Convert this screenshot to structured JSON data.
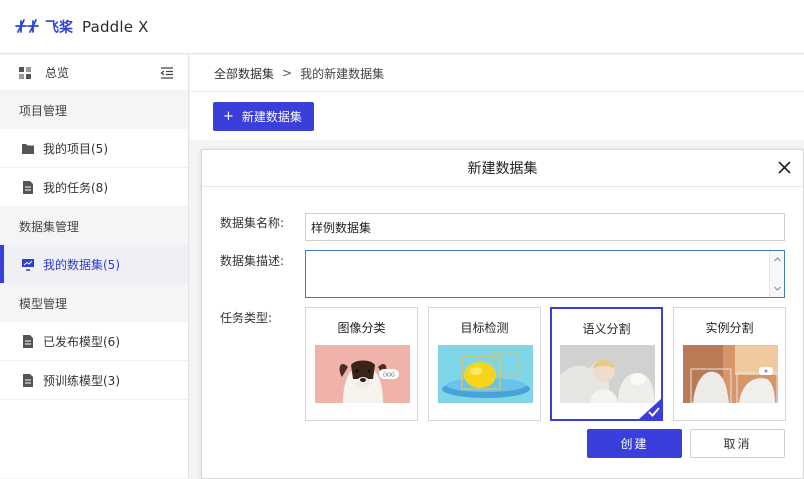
{
  "header": {
    "logo_text": "Paddle X",
    "logo_brand": "飞桨"
  },
  "sidebar": {
    "overview_label": "总览",
    "groups": [
      {
        "label": "项目管理",
        "items": [
          {
            "label": "我的项目(5)"
          },
          {
            "label": "我的任务(8)"
          }
        ]
      },
      {
        "label": "数据集管理",
        "items": [
          {
            "label": "我的数据集(5)",
            "active": true
          }
        ]
      },
      {
        "label": "模型管理",
        "items": [
          {
            "label": "已发布模型(6)"
          },
          {
            "label": "预训练模型(3)"
          }
        ]
      }
    ]
  },
  "breadcrumb": {
    "root": "全部数据集",
    "separator": ">",
    "current": "我的新建数据集"
  },
  "toolbar": {
    "new_dataset_label": "新建数据集",
    "plus": "+"
  },
  "modal": {
    "title": "新建数据集",
    "close": "×",
    "name_label": "数据集名称:",
    "name_value": "样例数据集",
    "desc_label": "数据集描述:",
    "desc_value": "",
    "type_label": "任务类型:",
    "task_types": [
      {
        "label": "图像分类",
        "image": "dog-photo",
        "selected": false
      },
      {
        "label": "目标检测",
        "image": "lemon-plate-photo",
        "selected": false
      },
      {
        "label": "语义分割",
        "image": "child-with-dog-photo",
        "selected": true
      },
      {
        "label": "实例分割",
        "image": "person-dog-detection-photo",
        "selected": false
      }
    ],
    "create_label": "创建",
    "cancel_label": "取消"
  },
  "colors": {
    "accent": "#3a3fdc",
    "focus_border": "#3a7fc6"
  }
}
